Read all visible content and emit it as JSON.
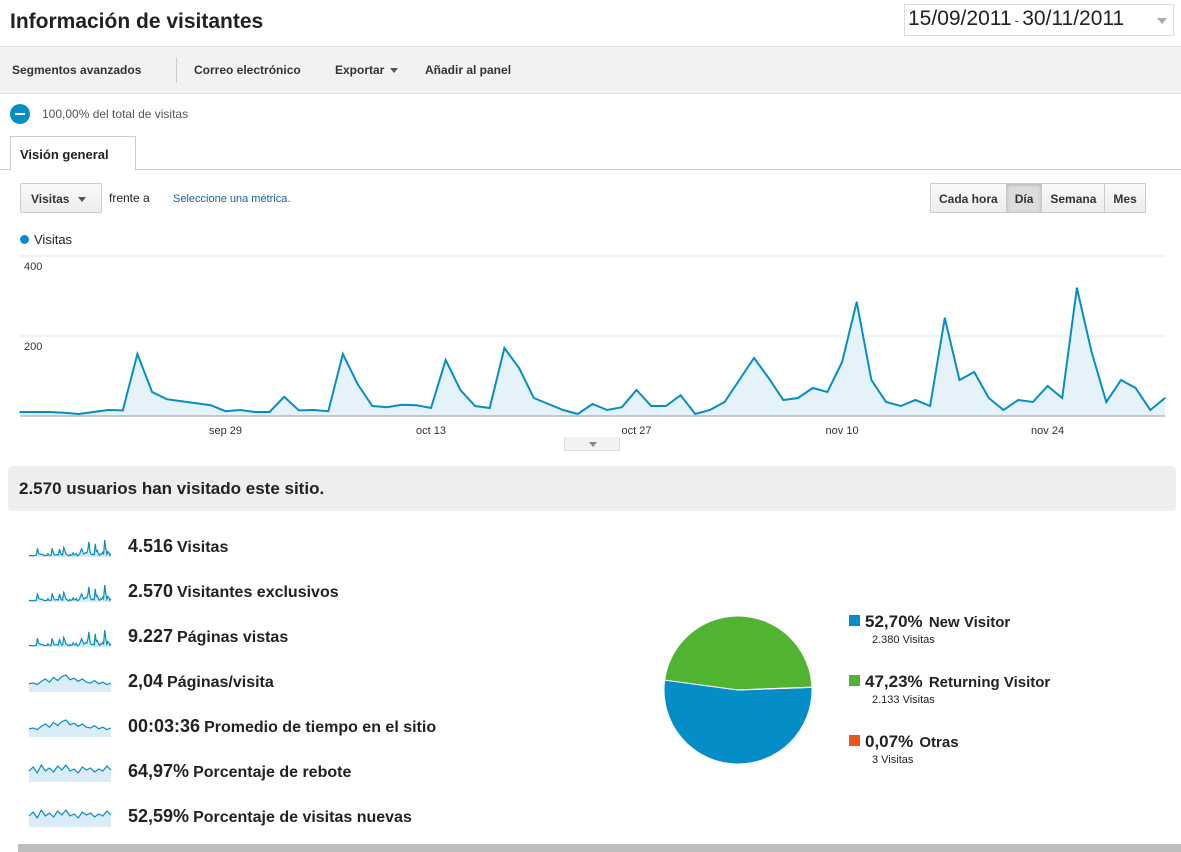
{
  "header": {
    "title": "Información de visitantes",
    "date_start": "15/09/2011",
    "date_sep": "-",
    "date_end": "30/11/2011"
  },
  "toolbar": {
    "segments": "Segmentos avanzados",
    "email": "Correo electrónico",
    "export": "Exportar",
    "add_dashboard": "Añadir al panel"
  },
  "segment": {
    "label": "100,00% del total de visitas"
  },
  "tabs": [
    {
      "label": "Visión general"
    }
  ],
  "controls": {
    "metric": "Visitas",
    "versus": "frente a",
    "select_metric": "Seleccione una métrica.",
    "granularity": [
      "Cada hora",
      "Día",
      "Semana",
      "Mes"
    ],
    "active_granularity": "Día"
  },
  "chart_data": {
    "type": "area",
    "series": [
      {
        "name": "Visitas",
        "color": "#058dc7",
        "values": [
          10,
          10,
          10,
          8,
          5,
          10,
          15,
          14,
          155,
          60,
          42,
          37,
          32,
          27,
          12,
          15,
          10,
          10,
          48,
          14,
          15,
          12,
          155,
          80,
          25,
          22,
          28,
          27,
          20,
          140,
          65,
          25,
          20,
          170,
          120,
          45,
          30,
          15,
          5,
          30,
          15,
          22,
          65,
          25,
          25,
          52,
          5,
          15,
          35,
          90,
          145,
          95,
          40,
          45,
          70,
          60,
          135,
          285,
          90,
          35,
          25,
          40,
          25,
          245,
          90,
          110,
          45,
          15,
          40,
          35,
          75,
          45,
          320,
          160,
          35,
          90,
          70,
          15,
          45
        ]
      }
    ],
    "x_ticks": [
      "sep 29",
      "oct 13",
      "oct 27",
      "nov 10",
      "nov 24"
    ],
    "y_ticks": [
      "400",
      "200"
    ],
    "ylim": [
      0,
      400
    ],
    "grid": true,
    "legend": "top-left"
  },
  "summary": {
    "headline": "2.570 usuarios han visitado este sitio."
  },
  "stats": [
    {
      "value": "4.516",
      "label": "Visitas",
      "spark": "visits"
    },
    {
      "value": "2.570",
      "label": "Visitantes exclusivos",
      "spark": "visits"
    },
    {
      "value": "9.227",
      "label": "Páginas vistas",
      "spark": "visits"
    },
    {
      "value": "2,04",
      "label": "Páginas/visita",
      "spark": "flat"
    },
    {
      "value": "00:03:36",
      "label": "Promedio de tiempo en el sitio",
      "spark": "flat"
    },
    {
      "value": "64,97%",
      "label": "Porcentaje de rebote",
      "spark": "high"
    },
    {
      "value": "52,59%",
      "label": "Porcentaje de visitas nuevas",
      "spark": "high"
    }
  ],
  "pie": {
    "slices": [
      {
        "pct": "52,70%",
        "name": "New Visitor",
        "sub": "2.380 Visitas",
        "value": 52.7,
        "color": "#058dc7"
      },
      {
        "pct": "47,23%",
        "name": "Returning Visitor",
        "sub": "2.133 Visitas",
        "value": 47.23,
        "color": "#50b432"
      },
      {
        "pct": "0,07%",
        "name": "Otras",
        "sub": "3 Visitas",
        "value": 0.07,
        "color": "#ed561b"
      }
    ]
  }
}
